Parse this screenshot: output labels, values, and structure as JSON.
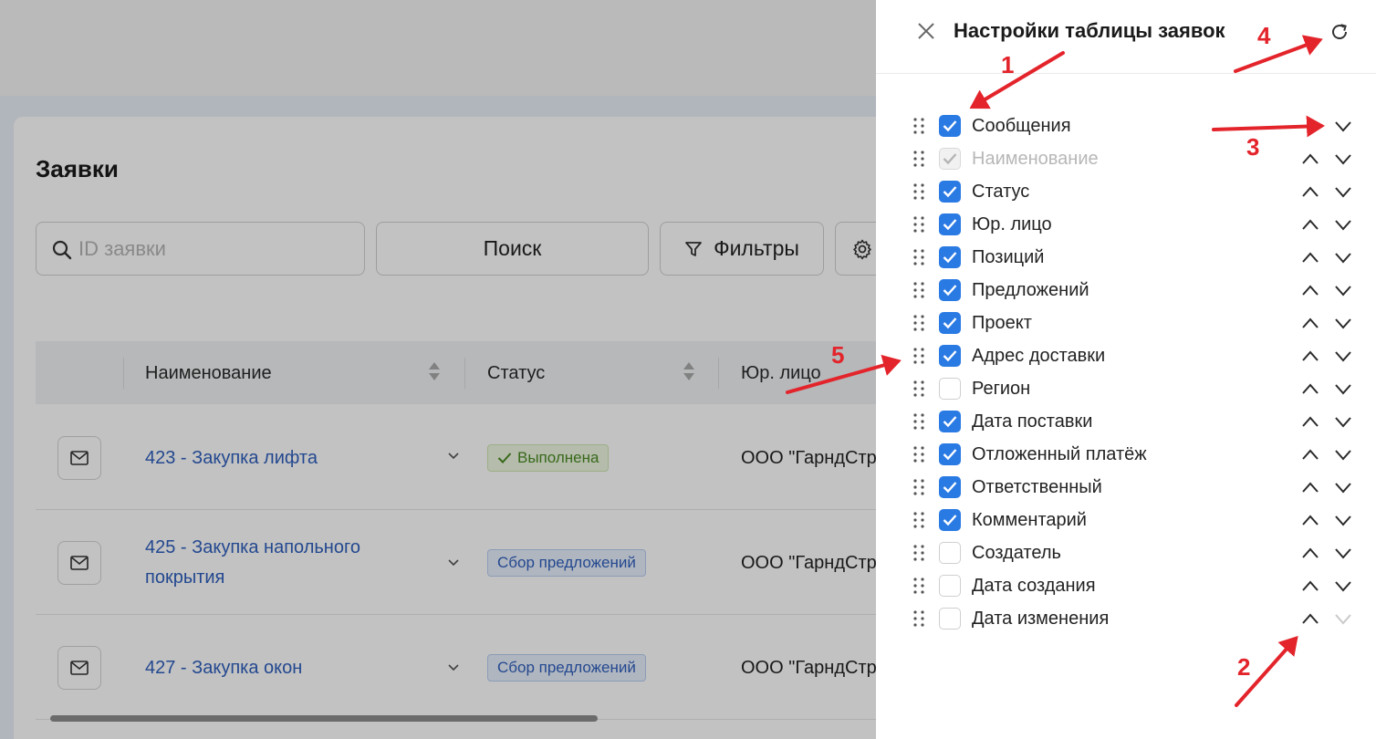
{
  "page": {
    "title": "Заявки",
    "search_placeholder": "ID заявки",
    "search_button": "Поиск",
    "filter_button": "Фильтры"
  },
  "table": {
    "columns": [
      "Наименование",
      "Статус",
      "Юр. лицо"
    ],
    "rows": [
      {
        "name": "423 - Закупка лифта",
        "status": "Выполнена",
        "status_kind": "done",
        "org": "ООО \"ГарндСтр"
      },
      {
        "name": "425 - Закупка напольного покрытия",
        "status": "Сбор предложений",
        "status_kind": "collect",
        "org": "ООО \"ГарндСтр"
      },
      {
        "name": "427 - Закупка окон",
        "status": "Сбор предложений",
        "status_kind": "collect",
        "org": "ООО \"ГарндСтр"
      }
    ]
  },
  "drawer": {
    "title": "Настройки таблицы заявок",
    "items": [
      {
        "label": "Сообщения",
        "checked": true,
        "disabled": false,
        "up": false,
        "down": true
      },
      {
        "label": "Наименование",
        "checked": true,
        "disabled": true,
        "up": true,
        "down": true
      },
      {
        "label": "Статус",
        "checked": true,
        "disabled": false,
        "up": true,
        "down": true
      },
      {
        "label": "Юр. лицо",
        "checked": true,
        "disabled": false,
        "up": true,
        "down": true
      },
      {
        "label": "Позиций",
        "checked": true,
        "disabled": false,
        "up": true,
        "down": true
      },
      {
        "label": "Предложений",
        "checked": true,
        "disabled": false,
        "up": true,
        "down": true
      },
      {
        "label": "Проект",
        "checked": true,
        "disabled": false,
        "up": true,
        "down": true
      },
      {
        "label": "Адрес доставки",
        "checked": true,
        "disabled": false,
        "up": true,
        "down": true
      },
      {
        "label": "Регион",
        "checked": false,
        "disabled": false,
        "up": true,
        "down": true
      },
      {
        "label": "Дата поставки",
        "checked": true,
        "disabled": false,
        "up": true,
        "down": true
      },
      {
        "label": "Отложенный платёж",
        "checked": true,
        "disabled": false,
        "up": true,
        "down": true
      },
      {
        "label": "Ответственный",
        "checked": true,
        "disabled": false,
        "up": true,
        "down": true
      },
      {
        "label": "Комментарий",
        "checked": true,
        "disabled": false,
        "up": true,
        "down": true
      },
      {
        "label": "Создатель",
        "checked": false,
        "disabled": false,
        "up": true,
        "down": true
      },
      {
        "label": "Дата создания",
        "checked": false,
        "disabled": false,
        "up": true,
        "down": true
      },
      {
        "label": "Дата изменения",
        "checked": false,
        "disabled": false,
        "up": true,
        "down": false
      }
    ]
  },
  "annotations": [
    {
      "number": "1"
    },
    {
      "number": "2"
    },
    {
      "number": "3"
    },
    {
      "number": "4"
    },
    {
      "number": "5"
    }
  ],
  "colors": {
    "accent": "#2a7ae4",
    "link": "#2f5fbd",
    "annotation": "#e3242b",
    "status_done": "#4a8a23"
  }
}
